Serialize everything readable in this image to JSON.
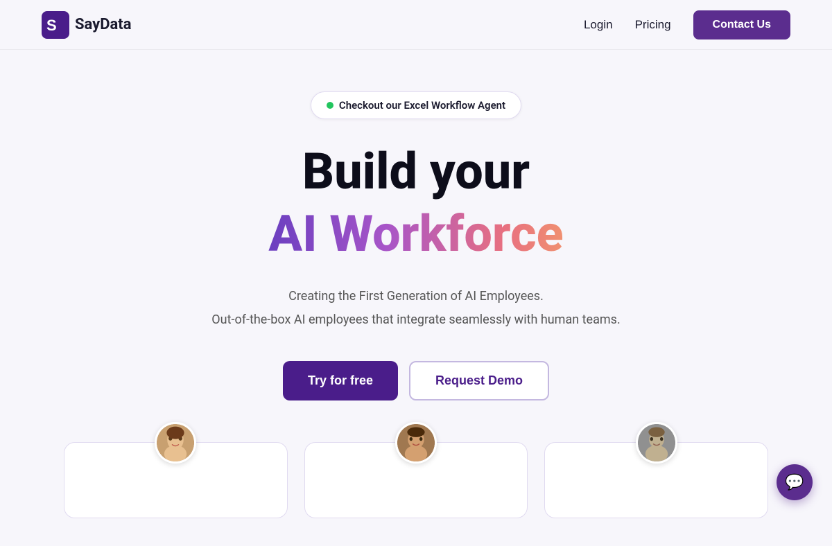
{
  "nav": {
    "logo_text": "SayData",
    "login_label": "Login",
    "pricing_label": "Pricing",
    "contact_label": "Contact Us"
  },
  "hero": {
    "badge_text": "Checkout our Excel Workflow Agent",
    "title_line1": "Build your",
    "title_line2": "AI Workforce",
    "subtitle1": "Creating the First Generation of AI Employees.",
    "subtitle2": "Out-of-the-box AI employees that integrate seamlessly with human teams.",
    "cta_try": "Try for free",
    "cta_demo": "Request Demo"
  },
  "cards": [
    {
      "id": "card-1",
      "avatar_label": "Woman avatar 1"
    },
    {
      "id": "card-2",
      "avatar_label": "Man avatar 2"
    },
    {
      "id": "card-3",
      "avatar_label": "Man avatar 3"
    }
  ],
  "chat": {
    "button_label": "Chat"
  }
}
